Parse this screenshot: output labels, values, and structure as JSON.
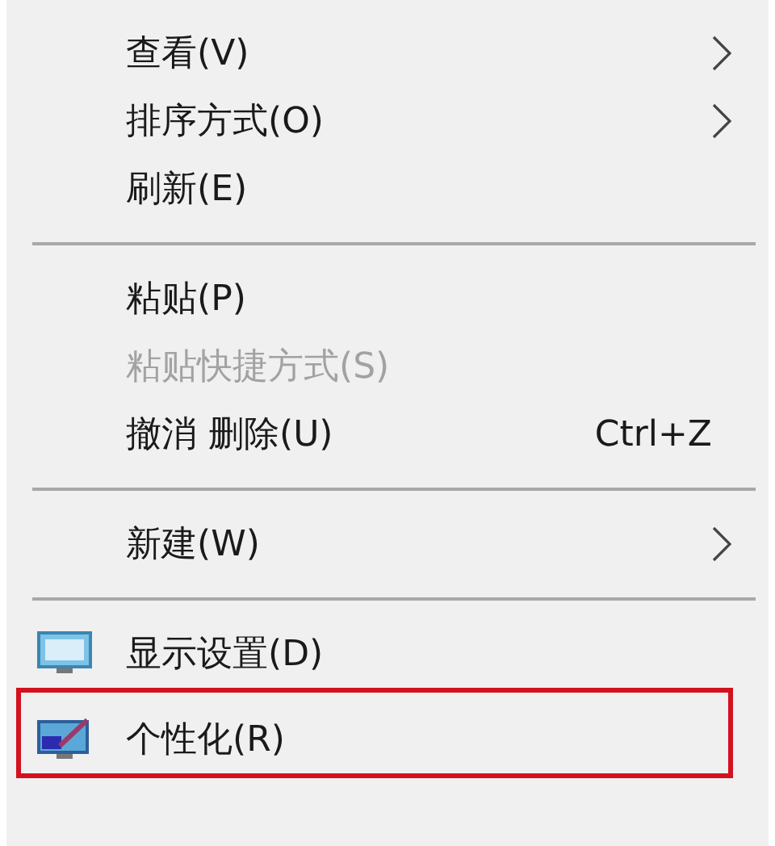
{
  "menu": {
    "items": [
      {
        "kind": "item",
        "label": "查看(V)",
        "submenu": true,
        "disabled": false
      },
      {
        "kind": "item",
        "label": "排序方式(O)",
        "submenu": true,
        "disabled": false
      },
      {
        "kind": "item",
        "label": "刷新(E)",
        "submenu": false,
        "disabled": false
      },
      {
        "kind": "separator"
      },
      {
        "kind": "item",
        "label": "粘贴(P)",
        "submenu": false,
        "disabled": false
      },
      {
        "kind": "item",
        "label": "粘贴快捷方式(S)",
        "submenu": false,
        "disabled": true
      },
      {
        "kind": "item",
        "label": "撤消 删除(U)",
        "shortcut": "Ctrl+Z",
        "submenu": false,
        "disabled": false
      },
      {
        "kind": "separator"
      },
      {
        "kind": "item",
        "label": "新建(W)",
        "submenu": true,
        "disabled": false
      },
      {
        "kind": "separator"
      },
      {
        "kind": "icon-item",
        "label": "显示设置(D)",
        "submenu": false,
        "disabled": false,
        "highlighted": false
      },
      {
        "kind": "icon-item",
        "label": "个性化(R)",
        "submenu": false,
        "disabled": false,
        "highlighted": true
      }
    ]
  }
}
